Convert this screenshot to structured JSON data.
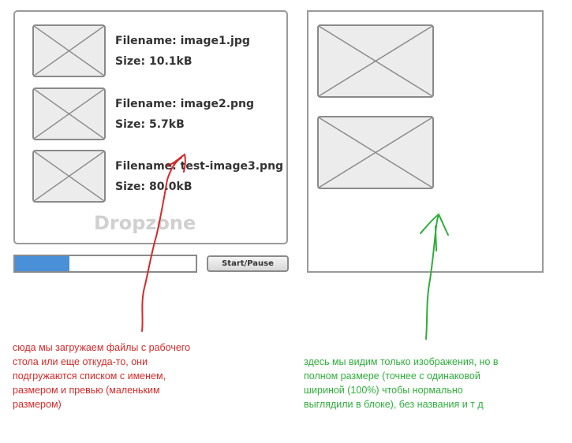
{
  "dropzone": {
    "label": "Dropzone",
    "files": [
      {
        "filename_label": "Filename: image1.jpg",
        "size_label": "Size: 10.1kB"
      },
      {
        "filename_label": "Filename: image2.png",
        "size_label": "Size: 5.7kB"
      },
      {
        "filename_label": "Filename: test-image3.png",
        "size_label": "Size: 80.0kB"
      }
    ]
  },
  "progress": {
    "value_percent": 30,
    "color": "#4a90d9"
  },
  "controls": {
    "start_pause_label": "Start/Pause"
  },
  "annotations": {
    "left_note": "сюда мы загружаем файлы с рабочего\nстола или еще откуда-то, они\nподгружаются списком с именем,\nразмером и превью (маленьким\nразмером)",
    "right_note": "здесь мы видим только изображения, но в\nполном размере (точнее с одинаковой\nшириной (100%) чтобы нормально\nвыглядили в блоке), без названия и т д",
    "left_color": "#d42a2a",
    "right_color": "#2fae3c"
  },
  "icons": {
    "thumbnail": "image-placeholder-icon"
  }
}
